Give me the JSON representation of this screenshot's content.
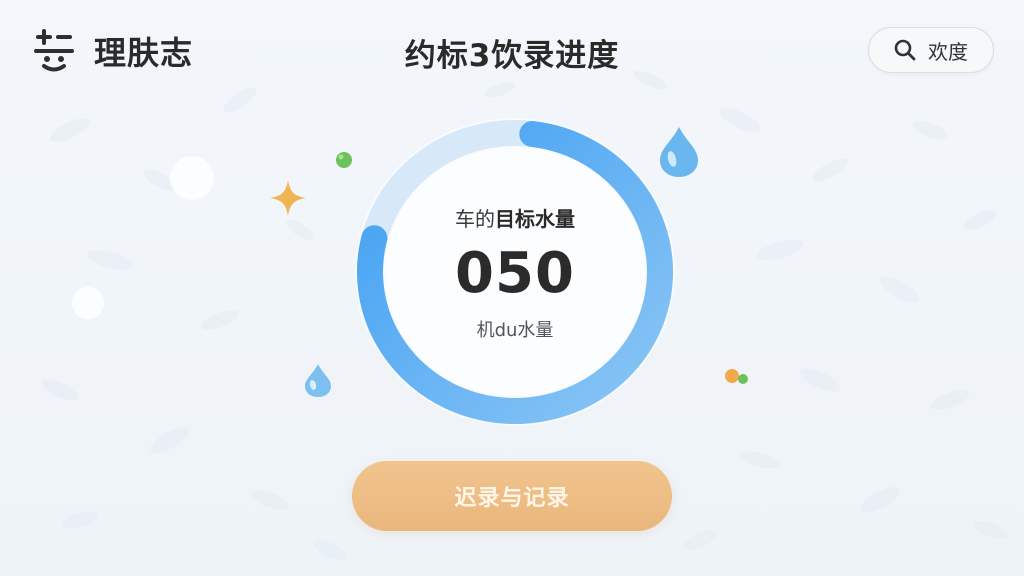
{
  "app": {
    "brand_name": "理肤志",
    "page_title": "约标3饮录进度"
  },
  "header": {
    "search_label": "欢度"
  },
  "progress": {
    "label_prefix": "车的",
    "label_strong": "目标水量",
    "value": "050",
    "sub_label": "机du水量",
    "fill_fraction": 0.77
  },
  "actions": {
    "record_label": "迟录与记录"
  },
  "colors": {
    "ring_track": "#d7e8f8",
    "ring_fill_start": "#3f9ff2",
    "ring_fill_end": "#8cc6f5",
    "button": "#ebb97f",
    "star": "#f0b552",
    "green_dot": "#6bc15a",
    "orange_dot": "#f2a94c",
    "water_drop": "#69b7ee"
  },
  "icons": {
    "brand": "smiling-face-logo",
    "search": "search-icon"
  }
}
